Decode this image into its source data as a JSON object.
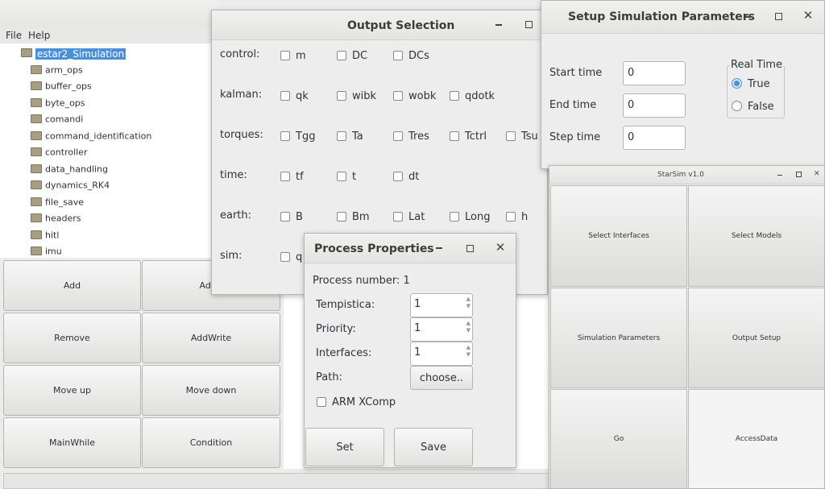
{
  "main": {
    "menu": [
      "File",
      "Help"
    ],
    "tree_root": "estar2_Simulation",
    "tree_items": [
      "arm_ops",
      "buffer_ops",
      "byte_ops",
      "comandi",
      "command_identification",
      "controller",
      "data_handling",
      "dynamics_RK4",
      "file_save",
      "headers",
      "hitl",
      "imu"
    ],
    "buttons": {
      "add": "Add",
      "addr": "AddR",
      "remove": "Remove",
      "addwrite": "AddWrite",
      "moveup": "Move up",
      "movedown": "Move down",
      "mainwhile": "MainWhile",
      "condition": "Condition"
    }
  },
  "output": {
    "title": "Output Selection",
    "rows": [
      {
        "label": "control:",
        "options": [
          "m",
          "DC",
          "DCs"
        ]
      },
      {
        "label": "kalman:",
        "options": [
          "qk",
          "wibk",
          "wobk",
          "qdotk"
        ]
      },
      {
        "label": "torques:",
        "options": [
          "Tgg",
          "Ta",
          "Tres",
          "Tctrl",
          "Tsu"
        ]
      },
      {
        "label": "time:",
        "options": [
          "tf",
          "t",
          "dt"
        ]
      },
      {
        "label": "earth:",
        "options": [
          "B",
          "Bm",
          "Lat",
          "Long",
          "h"
        ]
      },
      {
        "label": "sim:",
        "options": [
          "q"
        ]
      }
    ]
  },
  "setup": {
    "title": "Setup Simulation Parameters",
    "start_label": "Start time",
    "start_value": "0",
    "end_label": "End time",
    "end_value": "0",
    "step_label": "Step time",
    "step_value": "0",
    "realtime_label": "Real Time",
    "true_label": "True",
    "false_label": "False",
    "selected": "True"
  },
  "starsim": {
    "title": "StarSim v1.0",
    "buttons": [
      "Select Interfaces",
      "Select Models",
      "Simulation Parameters",
      "Output Setup",
      "Go",
      "AccessData"
    ]
  },
  "process": {
    "title": "Process Properties",
    "process_number": "Process number: 1",
    "tempistica_label": "Tempistica:",
    "tempistica_value": "1",
    "priority_label": "Priority:",
    "priority_value": "1",
    "interfaces_label": "Interfaces:",
    "interfaces_value": "1",
    "path_label": "Path:",
    "choose_label": "choose..",
    "armxcomp_label": "ARM XComp",
    "set_label": "Set",
    "save_label": "Save"
  },
  "colors": {
    "selection": "#4a90d9",
    "window_bg": "#ededed"
  }
}
